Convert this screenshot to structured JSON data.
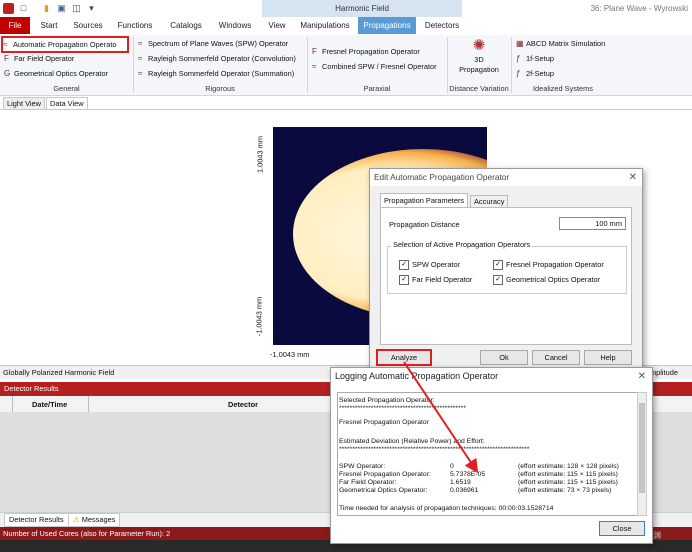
{
  "app": {
    "title": "36: Plane Wave - Wyrowski",
    "context_tab": "Harmonic Field"
  },
  "tabs": [
    "File",
    "Start",
    "Sources",
    "Functions",
    "Catalogs",
    "Windows",
    "View",
    "Manipulations",
    "Propagations",
    "Detectors"
  ],
  "ribbon": {
    "general": {
      "label": "General",
      "items": [
        "Automatic Propagation Operato",
        "Far Field Operator",
        "Geometrical Optics Operator"
      ]
    },
    "rigorous": {
      "label": "Rigorous",
      "items": [
        "Spectrum of Plane Waves (SPW) Operator",
        "Rayleigh Sommerfeld Operator (Convolution)",
        "Rayleigh Sommerfeld Operator (Summation)"
      ]
    },
    "paraxial": {
      "label": "Paraxial",
      "items": [
        "Fresnel Propagation Operator",
        "Combined SPW / Fresnel Operator"
      ]
    },
    "distance": {
      "label": "Distance Variation",
      "item_line1": "3D",
      "item_line2": "Propagation"
    },
    "idealized": {
      "label": "Idealized Systems",
      "items": [
        "ABCD Matrix Simulation",
        "1f-Setup",
        "2f-Setup"
      ]
    }
  },
  "view_tabs": [
    "Light View",
    "Data View"
  ],
  "plot": {
    "y_top": "1.0043 mm",
    "y_bottom": "-1.0043 mm",
    "x_left": "-1.0043 mm"
  },
  "strip": {
    "left": "Globally Polarized Harmonic Field",
    "right": "mplitude"
  },
  "detector": {
    "title": "Detector Results",
    "columns": [
      "Date/Time",
      "Detector"
    ]
  },
  "bottom_tabs": [
    "Detector Results",
    "Messages"
  ],
  "status": "Number of Used Cores (also for Parameter Run): 2",
  "watermark": "CSDN @谢渊",
  "edit_dialog": {
    "title": "Edit Automatic Propagation Operator",
    "tabs": [
      "Propagation Parameters",
      "Accuracy"
    ],
    "distance_label": "Propagation Distance",
    "distance_value": "100 mm",
    "group_label": "Selection of Active Propagation Operators",
    "checkboxes": [
      "SPW Operator",
      "Fresnel Propagation Operator",
      "Far Field Operator",
      "Geometrical Optics Operator"
    ],
    "buttons": {
      "analyze": "Analyze",
      "ok": "Ok",
      "cancel": "Cancel",
      "help": "Help"
    }
  },
  "log_dialog": {
    "title": "Logging Automatic Propagation Operator",
    "lines": {
      "selected": "Selected Propagation Operator:",
      "stars1": "************************************************",
      "selected_value": "Fresnel Propagation Operator",
      "estimated": "Estimated Deviation (Relative Power) and Effort:",
      "stars2": "************************************************************************"
    },
    "rows": [
      {
        "name": "SPW Operator:",
        "value": "0",
        "effort": "(effort estimate: 128 × 128 pixels)"
      },
      {
        "name": "Fresnel Propagation Operator:",
        "value": "5.7378E-05",
        "effort": "(effort estimate: 115 × 115 pixels)"
      },
      {
        "name": "Far Field Operator:",
        "value": "1.6519",
        "effort": "(effort estimate: 115 × 115 pixels)"
      },
      {
        "name": "Geometrical Optics Operator:",
        "value": "0.036961",
        "effort": "(effort estimate: 73 × 73 pixels)"
      }
    ],
    "time_line": "Time needed for analysis of propagation techniques: 00:00:03.1528714",
    "close": "Close"
  }
}
